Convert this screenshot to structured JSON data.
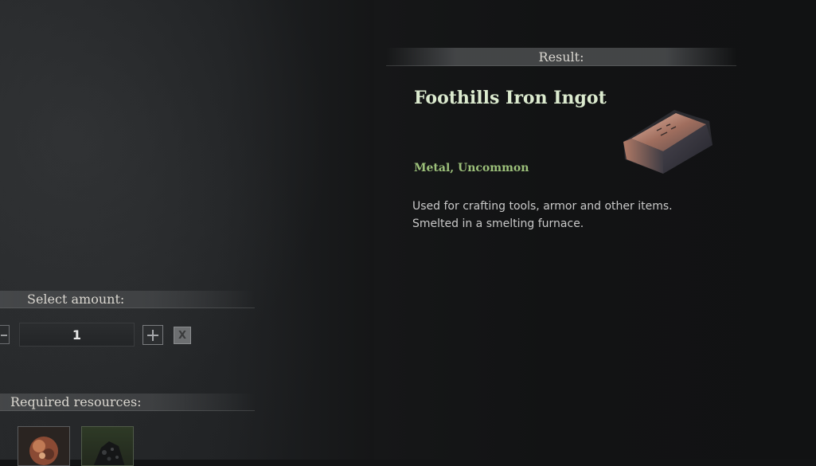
{
  "result_panel": {
    "header": "Result:",
    "item_name": "Foothills Iron Ingot",
    "item_type": "Metal, Uncommon",
    "description_lines": [
      "Used for crafting tools, armor and other items.",
      "Smelted in a smelting furnace."
    ],
    "icon": "iron-ingot-icon"
  },
  "amount": {
    "header": "Select amount:",
    "value": "1",
    "clear_label": "X",
    "decrease_icon": "minus-icon",
    "increase_icon": "plus-icon"
  },
  "resources": {
    "header": "Required resources:",
    "items": [
      {
        "icon": "iron-ore-icon"
      },
      {
        "icon": "coal-icon"
      }
    ]
  },
  "colors": {
    "item_name": "#dcebcf",
    "item_type": "#9cc07a",
    "background": "#131415"
  }
}
